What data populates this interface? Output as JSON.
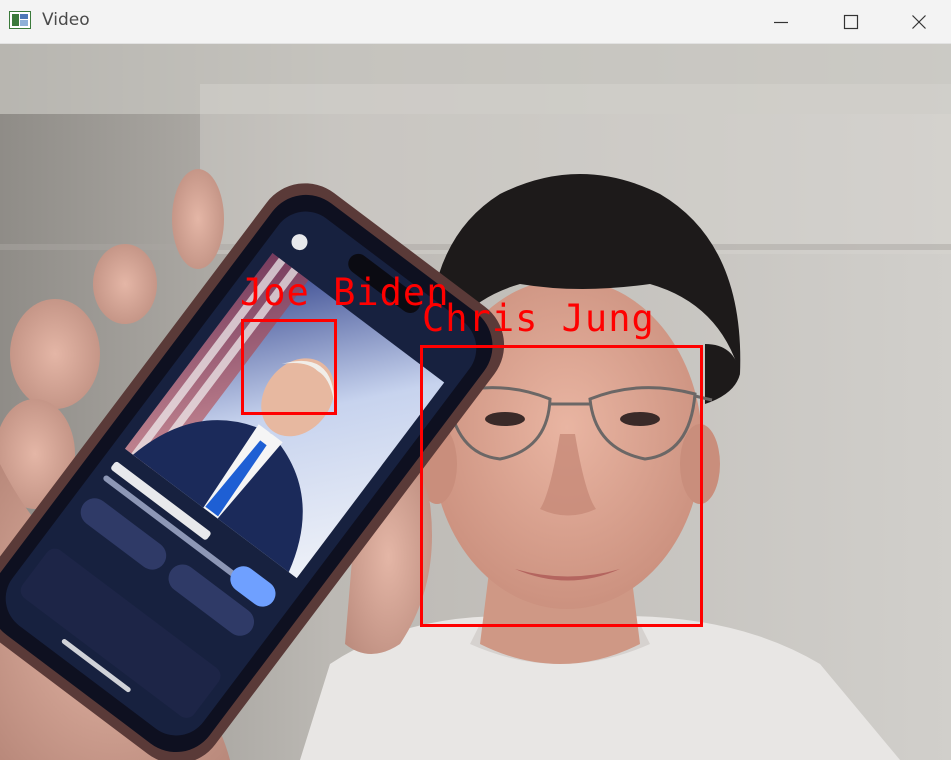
{
  "window": {
    "title": "Video",
    "controls": {
      "minimize": "minimize",
      "maximize": "maximize",
      "close": "close"
    }
  },
  "detections": [
    {
      "label": "Joe Biden"
    },
    {
      "label": "Chris Jung"
    }
  ],
  "colors": {
    "box": "#ff0000",
    "titlebar": "#f3f3f3"
  }
}
